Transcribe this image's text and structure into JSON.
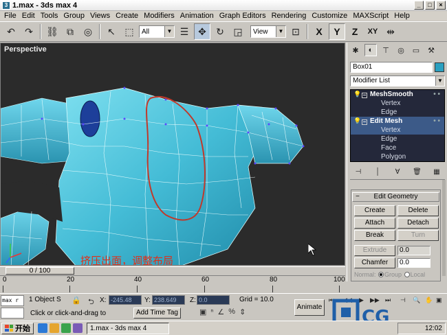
{
  "window": {
    "title": "1.max - 3ds max 4",
    "app_icon": "3ds-max-icon"
  },
  "menu": [
    "File",
    "Edit",
    "Tools",
    "Group",
    "Views",
    "Create",
    "Modifiers",
    "Animation",
    "Graph Editors",
    "Rendering",
    "Customize",
    "MAXScript",
    "Help"
  ],
  "toolbar": {
    "selection_filter": "All",
    "ref_coord": "View",
    "axes": [
      "X",
      "Y",
      "Z",
      "XY"
    ],
    "active_axis": "Y"
  },
  "viewport": {
    "label": "Perspective",
    "annotation": "挤压出面，调整布局",
    "mesh_color": "#4fc3dc",
    "highlight_color": "#c0392b"
  },
  "panel": {
    "object_name": "Box01",
    "object_color": "#2aa0c0",
    "modifier_list": "Modifier List",
    "stack": [
      {
        "type": "mod",
        "label": "MeshSmooth"
      },
      {
        "type": "sub",
        "label": "Vertex"
      },
      {
        "type": "sub",
        "label": "Edge"
      },
      {
        "type": "mod",
        "label": "Edit Mesh",
        "selected": true
      },
      {
        "type": "sub",
        "label": "Vertex",
        "selected": true
      },
      {
        "type": "sub",
        "label": "Edge"
      },
      {
        "type": "sub",
        "label": "Face"
      },
      {
        "type": "sub",
        "label": "Polygon"
      }
    ],
    "rollout": {
      "title": "Edit Geometry",
      "create": "Create",
      "delete": "Delete",
      "attach": "Attach",
      "detach": "Detach",
      "break": "Break",
      "turn": "Turn",
      "extrude": "Extrude",
      "extrude_value": "0.0",
      "chamfer": "Chamfer",
      "chamfer_value": "0.0",
      "normal": "Normal:",
      "group": "Group",
      "local": "Local"
    }
  },
  "time": {
    "frame": "0 / 100",
    "ruler": [
      "0",
      "20",
      "40",
      "60",
      "80",
      "100"
    ]
  },
  "status": {
    "maxscript": "max r",
    "selection": "1 Object S",
    "x_label": "X:",
    "x_value": "-245.48",
    "y_label": "Y:",
    "y_value": "238.649",
    "z_label": "Z:",
    "z_value": "0.0",
    "grid": "Grid = 10.0",
    "prompt": "Click or click-and-drag to",
    "add_time_tag": "Add Time Tag",
    "animate": "Animate"
  },
  "taskbar": {
    "start": "开始",
    "task": "1.max - 3ds max 4",
    "clock": "12:02"
  }
}
